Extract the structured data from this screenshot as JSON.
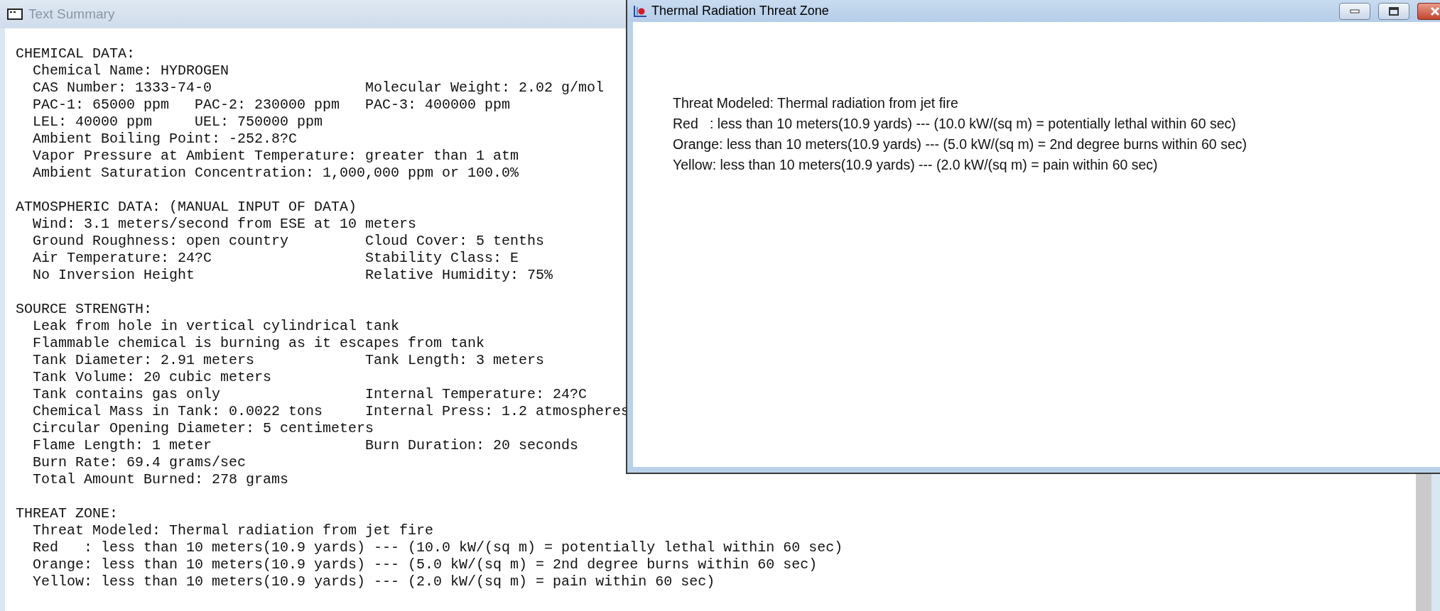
{
  "summary_window": {
    "title": "Text Summary",
    "active": false,
    "sections": [
      {
        "heading": "CHEMICAL DATA:",
        "rows": [
          {
            "kind": "single",
            "cells": [
              "Chemical Name: HYDROGEN"
            ]
          },
          {
            "kind": "grid",
            "cells": [
              "CAS Number: 1333-74-0",
              "",
              "Molecular Weight: 2.02 g/mol"
            ]
          },
          {
            "kind": "grid",
            "cells": [
              "PAC-1: 65000 ppm",
              "PAC-2: 230000 ppm",
              "PAC-3: 400000 ppm"
            ]
          },
          {
            "kind": "grid",
            "cells": [
              "LEL: 40000 ppm",
              "UEL: 750000 ppm"
            ]
          },
          {
            "kind": "single",
            "cells": [
              "Ambient Boiling Point: -252.8?C"
            ]
          },
          {
            "kind": "single",
            "cells": [
              "Vapor Pressure at Ambient Temperature: greater than 1 atm"
            ]
          },
          {
            "kind": "single",
            "cells": [
              "Ambient Saturation Concentration: 1,000,000 ppm or 100.0%"
            ]
          }
        ]
      },
      {
        "heading": "ATMOSPHERIC DATA: (MANUAL INPUT OF DATA)",
        "rows": [
          {
            "kind": "single",
            "cells": [
              "Wind: 3.1 meters/second from ESE at 10 meters"
            ]
          },
          {
            "kind": "grid",
            "cells": [
              "Ground Roughness: open country",
              "",
              "Cloud Cover: 5 tenths"
            ]
          },
          {
            "kind": "grid",
            "cells": [
              "Air Temperature: 24?C",
              "",
              "Stability Class: E"
            ]
          },
          {
            "kind": "grid",
            "cells": [
              "No Inversion Height",
              "",
              "Relative Humidity: 75%"
            ]
          }
        ]
      },
      {
        "heading": "SOURCE STRENGTH:",
        "rows": [
          {
            "kind": "single",
            "cells": [
              "Leak from hole in vertical cylindrical tank"
            ]
          },
          {
            "kind": "single",
            "cells": [
              "Flammable chemical is burning as it escapes from tank"
            ]
          },
          {
            "kind": "grid",
            "cells": [
              "Tank Diameter: 2.91 meters",
              "",
              "Tank Length: 3 meters"
            ]
          },
          {
            "kind": "single",
            "cells": [
              "Tank Volume: 20 cubic meters"
            ]
          },
          {
            "kind": "grid",
            "cells": [
              "Tank contains gas only",
              "",
              "Internal Temperature: 24?C"
            ]
          },
          {
            "kind": "grid",
            "cells": [
              "Chemical Mass in Tank: 0.0022 tons",
              "",
              "Internal Press: 1.2 atmospheres"
            ]
          },
          {
            "kind": "single",
            "cells": [
              "Circular Opening Diameter: 5 centimeters"
            ]
          },
          {
            "kind": "grid",
            "cells": [
              "Flame Length: 1 meter",
              "",
              "Burn Duration: 20 seconds"
            ]
          },
          {
            "kind": "single",
            "cells": [
              "Burn Rate: 69.4 grams/sec"
            ]
          },
          {
            "kind": "single",
            "cells": [
              "Total Amount Burned: 278 grams"
            ]
          }
        ]
      },
      {
        "heading": "THREAT ZONE:",
        "rows": [
          {
            "kind": "single",
            "cells": [
              "Threat Modeled: Thermal radiation from jet fire"
            ]
          },
          {
            "kind": "single",
            "cells": [
              "Red   : less than 10 meters(10.9 yards) --- (10.0 kW/(sq m) = potentially lethal within 60 sec)"
            ]
          },
          {
            "kind": "single",
            "cells": [
              "Orange: less than 10 meters(10.9 yards) --- (5.0 kW/(sq m) = 2nd degree burns within 60 sec)"
            ]
          },
          {
            "kind": "single",
            "cells": [
              "Yellow: less than 10 meters(10.9 yards) --- (2.0 kW/(sq m) = pain within 60 sec)"
            ]
          }
        ]
      }
    ]
  },
  "threat_window": {
    "title": "Thermal Radiation Threat Zone",
    "active": true,
    "lines": [
      "Threat Modeled: Thermal radiation from jet fire",
      "Red   : less than 10 meters(10.9 yards) --- (10.0 kW/(sq m) = potentially lethal within 60 sec)",
      "Orange: less than 10 meters(10.9 yards) --- (5.0 kW/(sq m) = 2nd degree burns within 60 sec)",
      "Yellow: less than 10 meters(10.9 yards) --- (2.0 kW/(sq m) = pain within 60 sec)"
    ]
  }
}
